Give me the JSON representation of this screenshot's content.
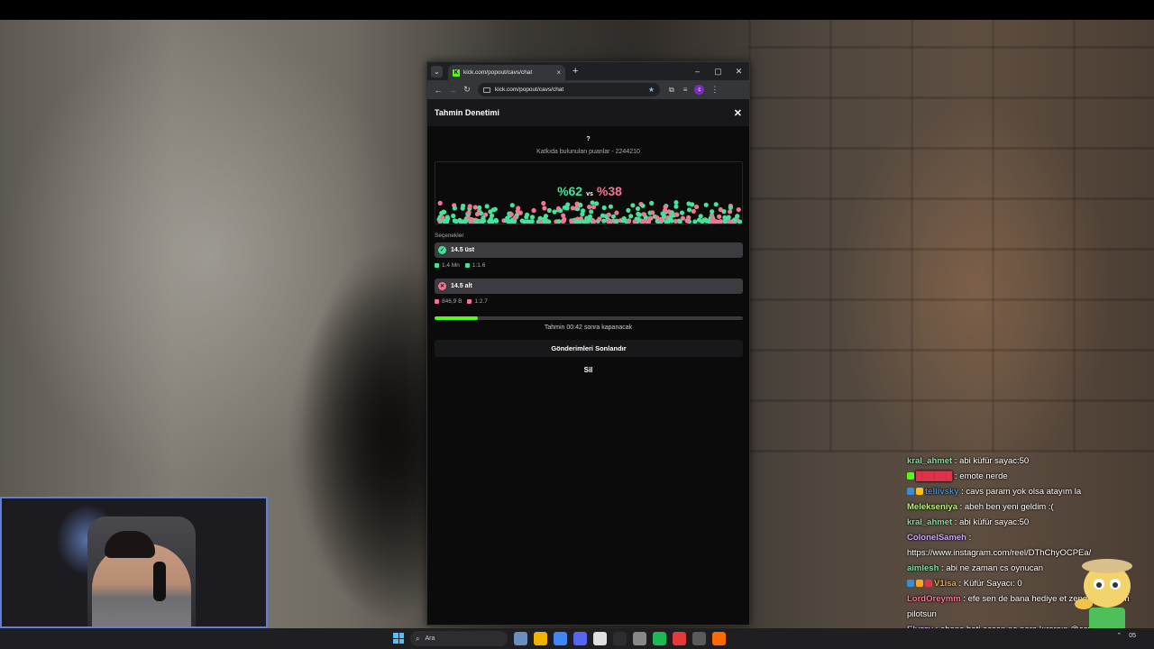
{
  "browser": {
    "tab_title": "kick.com/popout/cavs/chat",
    "tab_favicon": "K",
    "new_tab": "+",
    "url": "kick.com/popout/cavs/chat",
    "profile_initial": "c",
    "controls": {
      "minimize": "–",
      "maximize": "▢",
      "close": "✕"
    }
  },
  "prediction": {
    "header_title": "Tahmin Denetimi",
    "close_icon": "✕",
    "question": "?",
    "points_text": "Katkıda bulunulan puanlar - 2244210",
    "percent_left": "%62",
    "vs": "vs",
    "percent_right": "%38",
    "share_green": 0.62,
    "colors": {
      "green": "#42e39b",
      "red": "#f27592"
    },
    "options_label": "Seçenekler",
    "options": [
      {
        "label": "14.5 üst",
        "amount": "1,4 Mn",
        "ratio": "1:1.6",
        "color": "#42e39b"
      },
      {
        "label": "14.5 alt",
        "amount": "846,9 B",
        "ratio": "1:2.7",
        "color": "#f27592"
      }
    ],
    "progress": 0.14,
    "progress_color": "#53fc18",
    "timer_text": "Tahmin 00:42 sonra kapanacak",
    "end_button": "Gönderimleri Sonlandır",
    "delete_button": "Sil"
  },
  "chat": [
    {
      "user": "kral_ahmet",
      "color": "#7ee0a0",
      "text": " : abi küfür sayac:50",
      "badges": []
    },
    {
      "user": "██████",
      "color": "#e0334a",
      "text": " : emote nerde",
      "badges": [
        "#53fc18"
      ]
    },
    {
      "user": "tellivsky",
      "color": "#3a8bd8",
      "text": " : cavs param yok olsa atayım la",
      "badges": [
        "#3a8bd8",
        "#f5c518"
      ]
    },
    {
      "user": "Melekseniya",
      "color": "#b6f07a",
      "text": " : abeh ben yeni geldim :(",
      "badges": []
    },
    {
      "user": "kral_ahmet",
      "color": "#7ee0a0",
      "text": " : abi küfür sayac:50",
      "badges": []
    },
    {
      "user": "ColonelSameh",
      "color": "#c9a6ff",
      "text": " :",
      "badges": []
    },
    {
      "user": "",
      "color": "#ffffff",
      "text": "https://www.instagram.com/reel/DThChyOCPEa/",
      "badges": []
    },
    {
      "user": "aimlesh",
      "color": "#7ee0a0",
      "text": " : abi ne zaman cs oynucan",
      "badges": []
    },
    {
      "user": "V1isa",
      "color": "#f0a040",
      "text": " : Küfür Sayacı: 0",
      "badges": [
        "#3a8bd8",
        "#f5a623",
        "#e0334a"
      ]
    },
    {
      "user": "LordOreymm",
      "color": "#f27592",
      "text": " : efe sen de bana hediye et zengin adamsın",
      "badges": []
    },
    {
      "user": "",
      "color": "#ffffff",
      "text": "pilotsun",
      "badges": []
    },
    {
      "user": "Elvzzy",
      "color": "#c9a6ff",
      "text": " : abone beti açsan ne para kırarsın @cavs",
      "badges": []
    }
  ],
  "taskbar": {
    "search_placeholder": "Ara",
    "icon_colors": [
      "#6c8ebf",
      "#f0b400",
      "#4285f4",
      "#5865f2",
      "#e0e0e0",
      "#2d2d31",
      "#888888",
      "#1db954",
      "#e33b3b",
      "#5a5a5a",
      "#ff6a00"
    ],
    "tray_time": "05"
  }
}
